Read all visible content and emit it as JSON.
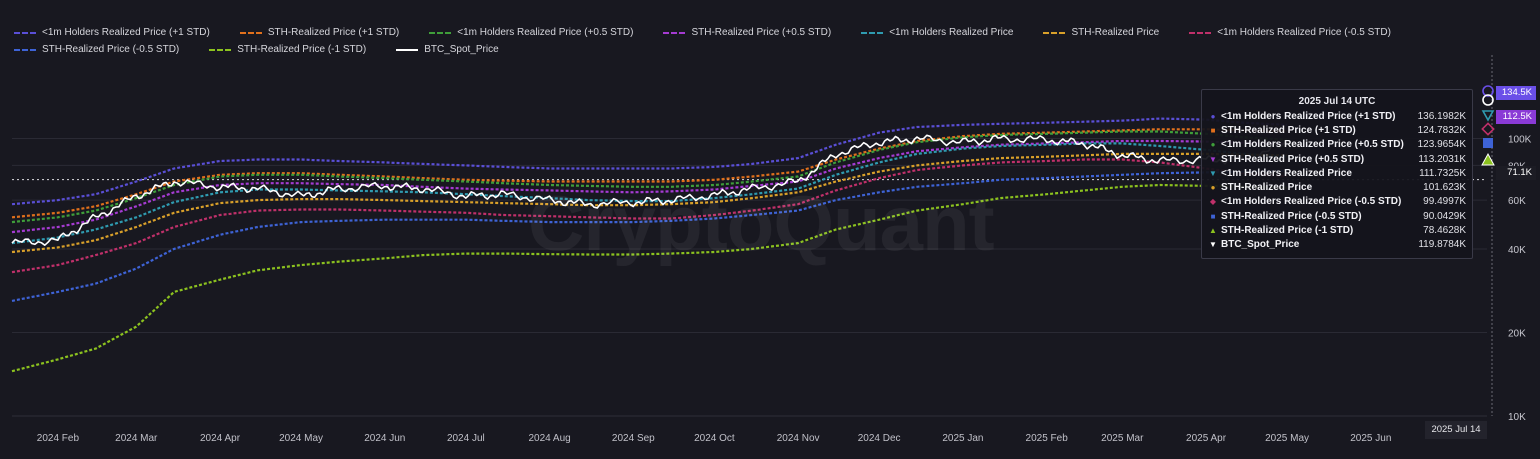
{
  "watermark": "CryptoQuant",
  "tooltip": {
    "date": "2025 Jul 14 UTC",
    "rows": [
      {
        "name": "<1m Holders Realized Price (+1 STD)",
        "value": "136.1982K",
        "marker": "●",
        "color": "#5a4fd6"
      },
      {
        "name": "STH-Realized Price (+1 STD)",
        "value": "124.7832K",
        "marker": "■",
        "color": "#e0701c"
      },
      {
        "name": "<1m Holders Realized Price (+0.5 STD)",
        "value": "123.9654K",
        "marker": "●",
        "color": "#3f9e3a"
      },
      {
        "name": "STH-Realized Price (+0.5 STD)",
        "value": "113.2031K",
        "marker": "▼",
        "color": "#a53bd2"
      },
      {
        "name": "<1m Holders Realized Price",
        "value": "111.7325K",
        "marker": "▼",
        "color": "#2f9bb0"
      },
      {
        "name": "STH-Realized Price",
        "value": "101.623K",
        "marker": "●",
        "color": "#d9a02a"
      },
      {
        "name": "<1m Holders Realized Price (-0.5 STD)",
        "value": "99.4997K",
        "marker": "◆",
        "color": "#c0306a"
      },
      {
        "name": "STH-Realized Price (-0.5 STD)",
        "value": "90.0429K",
        "marker": "■",
        "color": "#3e63d6"
      },
      {
        "name": "STH-Realized Price (-1 STD)",
        "value": "78.4628K",
        "marker": "▲",
        "color": "#8cc21f"
      },
      {
        "name": "BTC_Spot_Price",
        "value": "119.8784K",
        "marker": "▼",
        "color": "#ffffff"
      }
    ]
  },
  "date_badge": "2025 Jul 14",
  "right_tags": [
    {
      "text": "134.5K",
      "color": "#6a4fe8"
    },
    {
      "text": "112.5K",
      "color": "#8a3ad6"
    },
    {
      "text": "71.1K",
      "color": "#1c1c24"
    }
  ],
  "chart_data": {
    "type": "line",
    "title": "",
    "xlabel": "",
    "ylabel": "",
    "y_scale": "log",
    "ylim": [
      10000,
      200000
    ],
    "y_ticks": [
      {
        "label": "10K",
        "value": 10000
      },
      {
        "label": "20K",
        "value": 20000
      },
      {
        "label": "40K",
        "value": 40000
      },
      {
        "label": "60K",
        "value": 60000
      },
      {
        "label": "80K",
        "value": 80000
      },
      {
        "label": "100K",
        "value": 100000
      }
    ],
    "x_ticks": [
      "2024 Feb",
      "2024 Mar",
      "2024 Apr",
      "2024 May",
      "2024 Jun",
      "2024 Jul",
      "2024 Aug",
      "2024 Sep",
      "2024 Oct",
      "2024 Nov",
      "2024 Dec",
      "2025 Jan",
      "2025 Feb",
      "2025 Mar",
      "2025 Apr",
      "2025 May",
      "2025 Jun"
    ],
    "x_range": [
      "2024-01-15",
      "2025-07-14"
    ],
    "grid": true,
    "legend": "top",
    "current_price_line": 71100,
    "dates": [
      "2024-01-15",
      "2024-02-01",
      "2024-02-15",
      "2024-03-01",
      "2024-03-15",
      "2024-04-01",
      "2024-04-15",
      "2024-05-01",
      "2024-05-15",
      "2024-06-01",
      "2024-06-15",
      "2024-07-01",
      "2024-07-15",
      "2024-08-01",
      "2024-08-15",
      "2024-09-01",
      "2024-09-15",
      "2024-10-01",
      "2024-10-15",
      "2024-11-01",
      "2024-11-15",
      "2024-12-01",
      "2024-12-15",
      "2025-01-01",
      "2025-01-15",
      "2025-02-01",
      "2025-02-15",
      "2025-03-01",
      "2025-03-15",
      "2025-04-01",
      "2025-04-15",
      "2025-05-01"
    ],
    "series": [
      {
        "name": "<1m Holders Realized Price (+1 STD)",
        "color": "#5a4fd6",
        "values": [
          58000,
          60000,
          63000,
          70000,
          78000,
          83000,
          84000,
          84000,
          83000,
          82000,
          81000,
          80000,
          79000,
          78000,
          78000,
          78000,
          78000,
          79000,
          81000,
          85000,
          95000,
          105000,
          110000,
          112000,
          113000,
          114000,
          115000,
          116000,
          118000,
          117000,
          114000,
          112000
        ]
      },
      {
        "name": "STH-Realized Price (+1 STD)",
        "color": "#e0701c",
        "values": [
          52000,
          54000,
          57000,
          63000,
          70000,
          74000,
          75000,
          75000,
          74000,
          73000,
          72000,
          71000,
          70500,
          70000,
          70000,
          70000,
          70000,
          71000,
          73000,
          76000,
          84000,
          92000,
          98000,
          102000,
          104000,
          105000,
          106000,
          107000,
          108000,
          108000,
          107000,
          106000
        ]
      },
      {
        "name": "<1m Holders Realized Price (+0.5 STD)",
        "color": "#3f9e3a",
        "values": [
          50000,
          52000,
          55000,
          61000,
          68000,
          73000,
          74000,
          74000,
          73000,
          72000,
          71000,
          70000,
          69000,
          68000,
          67500,
          67000,
          67000,
          68000,
          70000,
          73000,
          82000,
          91000,
          97000,
          101000,
          103000,
          104000,
          105000,
          106000,
          106000,
          104000,
          101000,
          99000
        ]
      },
      {
        "name": "STH-Realized Price (+0.5 STD)",
        "color": "#a53bd2",
        "values": [
          46000,
          48000,
          51000,
          57000,
          64000,
          68000,
          69000,
          69000,
          68500,
          68000,
          67000,
          66000,
          65500,
          65000,
          64500,
          64000,
          64500,
          65500,
          67500,
          70000,
          78000,
          85000,
          90000,
          93000,
          95000,
          96000,
          97000,
          98000,
          98000,
          97500,
          96500,
          95500
        ]
      },
      {
        "name": "<1m Holders Realized Price",
        "color": "#2f9bb0",
        "values": [
          42000,
          44000,
          47000,
          52000,
          59000,
          64000,
          65500,
          65500,
          65000,
          64500,
          64000,
          63000,
          62000,
          61000,
          60000,
          59500,
          59500,
          61000,
          63000,
          66000,
          74000,
          82000,
          88000,
          92000,
          94000,
          95000,
          96000,
          96000,
          94000,
          91000,
          88000,
          86000
        ]
      },
      {
        "name": "STH-Realized Price",
        "color": "#d9a02a",
        "values": [
          39000,
          40500,
          43000,
          48000,
          54000,
          58500,
          60000,
          60500,
          60500,
          60000,
          59500,
          59000,
          58500,
          58000,
          57500,
          57500,
          58000,
          59000,
          61000,
          64000,
          70000,
          76000,
          80000,
          83000,
          85000,
          86000,
          87000,
          88000,
          88000,
          88000,
          87500,
          87000
        ]
      },
      {
        "name": "<1m Holders Realized Price (-0.5 STD)",
        "color": "#c0306a",
        "values": [
          33000,
          35000,
          38000,
          42000,
          48000,
          53000,
          55000,
          55500,
          55500,
          55000,
          54500,
          54000,
          53000,
          52500,
          52000,
          51500,
          51500,
          53000,
          55000,
          58000,
          65000,
          72000,
          77000,
          80000,
          82000,
          83000,
          84000,
          84000,
          82000,
          78000,
          75000,
          73000
        ]
      },
      {
        "name": "STH-Realized Price (-0.5 STD)",
        "color": "#3e63d6",
        "values": [
          26000,
          28000,
          30000,
          34000,
          40000,
          45000,
          48000,
          50000,
          50500,
          51000,
          51000,
          51000,
          50500,
          50000,
          50000,
          50000,
          50500,
          51500,
          53000,
          55000,
          60000,
          64000,
          67000,
          69000,
          71000,
          72000,
          73000,
          74000,
          75000,
          75500,
          76000,
          76500
        ]
      },
      {
        "name": "STH-Realized Price (-1 STD)",
        "color": "#8cc21f",
        "values": [
          14500,
          16000,
          17500,
          21000,
          28000,
          31000,
          33500,
          35000,
          36000,
          37000,
          38000,
          38500,
          38500,
          38300,
          38200,
          38200,
          38500,
          39000,
          40000,
          42000,
          47000,
          51000,
          55000,
          58000,
          61000,
          63000,
          65000,
          67000,
          68000,
          67500,
          67000,
          66500
        ]
      },
      {
        "name": "BTC_Spot_Price",
        "color": "#ffffff",
        "values": [
          42000,
          43000,
          52000,
          62000,
          70000,
          67000,
          66000,
          62000,
          66000,
          67500,
          66000,
          62000,
          63000,
          60000,
          58000,
          59000,
          60000,
          62500,
          66000,
          70000,
          88000,
          97000,
          100000,
          97000,
          100000,
          99000,
          96000,
          87000,
          83000,
          84000,
          84000,
          96000
        ]
      }
    ]
  }
}
